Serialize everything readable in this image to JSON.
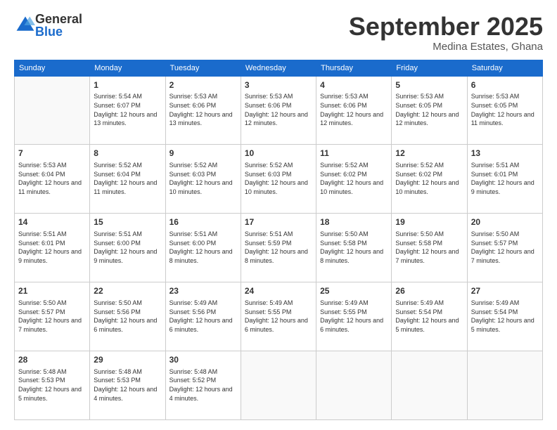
{
  "header": {
    "logo_general": "General",
    "logo_blue": "Blue",
    "month_title": "September 2025",
    "location": "Medina Estates, Ghana"
  },
  "days_of_week": [
    "Sunday",
    "Monday",
    "Tuesday",
    "Wednesday",
    "Thursday",
    "Friday",
    "Saturday"
  ],
  "weeks": [
    [
      {
        "day": "",
        "sunrise": "",
        "sunset": "",
        "daylight": ""
      },
      {
        "day": "1",
        "sunrise": "Sunrise: 5:54 AM",
        "sunset": "Sunset: 6:07 PM",
        "daylight": "Daylight: 12 hours and 13 minutes."
      },
      {
        "day": "2",
        "sunrise": "Sunrise: 5:53 AM",
        "sunset": "Sunset: 6:06 PM",
        "daylight": "Daylight: 12 hours and 13 minutes."
      },
      {
        "day": "3",
        "sunrise": "Sunrise: 5:53 AM",
        "sunset": "Sunset: 6:06 PM",
        "daylight": "Daylight: 12 hours and 12 minutes."
      },
      {
        "day": "4",
        "sunrise": "Sunrise: 5:53 AM",
        "sunset": "Sunset: 6:06 PM",
        "daylight": "Daylight: 12 hours and 12 minutes."
      },
      {
        "day": "5",
        "sunrise": "Sunrise: 5:53 AM",
        "sunset": "Sunset: 6:05 PM",
        "daylight": "Daylight: 12 hours and 12 minutes."
      },
      {
        "day": "6",
        "sunrise": "Sunrise: 5:53 AM",
        "sunset": "Sunset: 6:05 PM",
        "daylight": "Daylight: 12 hours and 11 minutes."
      }
    ],
    [
      {
        "day": "7",
        "sunrise": "Sunrise: 5:53 AM",
        "sunset": "Sunset: 6:04 PM",
        "daylight": "Daylight: 12 hours and 11 minutes."
      },
      {
        "day": "8",
        "sunrise": "Sunrise: 5:52 AM",
        "sunset": "Sunset: 6:04 PM",
        "daylight": "Daylight: 12 hours and 11 minutes."
      },
      {
        "day": "9",
        "sunrise": "Sunrise: 5:52 AM",
        "sunset": "Sunset: 6:03 PM",
        "daylight": "Daylight: 12 hours and 10 minutes."
      },
      {
        "day": "10",
        "sunrise": "Sunrise: 5:52 AM",
        "sunset": "Sunset: 6:03 PM",
        "daylight": "Daylight: 12 hours and 10 minutes."
      },
      {
        "day": "11",
        "sunrise": "Sunrise: 5:52 AM",
        "sunset": "Sunset: 6:02 PM",
        "daylight": "Daylight: 12 hours and 10 minutes."
      },
      {
        "day": "12",
        "sunrise": "Sunrise: 5:52 AM",
        "sunset": "Sunset: 6:02 PM",
        "daylight": "Daylight: 12 hours and 10 minutes."
      },
      {
        "day": "13",
        "sunrise": "Sunrise: 5:51 AM",
        "sunset": "Sunset: 6:01 PM",
        "daylight": "Daylight: 12 hours and 9 minutes."
      }
    ],
    [
      {
        "day": "14",
        "sunrise": "Sunrise: 5:51 AM",
        "sunset": "Sunset: 6:01 PM",
        "daylight": "Daylight: 12 hours and 9 minutes."
      },
      {
        "day": "15",
        "sunrise": "Sunrise: 5:51 AM",
        "sunset": "Sunset: 6:00 PM",
        "daylight": "Daylight: 12 hours and 9 minutes."
      },
      {
        "day": "16",
        "sunrise": "Sunrise: 5:51 AM",
        "sunset": "Sunset: 6:00 PM",
        "daylight": "Daylight: 12 hours and 8 minutes."
      },
      {
        "day": "17",
        "sunrise": "Sunrise: 5:51 AM",
        "sunset": "Sunset: 5:59 PM",
        "daylight": "Daylight: 12 hours and 8 minutes."
      },
      {
        "day": "18",
        "sunrise": "Sunrise: 5:50 AM",
        "sunset": "Sunset: 5:58 PM",
        "daylight": "Daylight: 12 hours and 8 minutes."
      },
      {
        "day": "19",
        "sunrise": "Sunrise: 5:50 AM",
        "sunset": "Sunset: 5:58 PM",
        "daylight": "Daylight: 12 hours and 7 minutes."
      },
      {
        "day": "20",
        "sunrise": "Sunrise: 5:50 AM",
        "sunset": "Sunset: 5:57 PM",
        "daylight": "Daylight: 12 hours and 7 minutes."
      }
    ],
    [
      {
        "day": "21",
        "sunrise": "Sunrise: 5:50 AM",
        "sunset": "Sunset: 5:57 PM",
        "daylight": "Daylight: 12 hours and 7 minutes."
      },
      {
        "day": "22",
        "sunrise": "Sunrise: 5:50 AM",
        "sunset": "Sunset: 5:56 PM",
        "daylight": "Daylight: 12 hours and 6 minutes."
      },
      {
        "day": "23",
        "sunrise": "Sunrise: 5:49 AM",
        "sunset": "Sunset: 5:56 PM",
        "daylight": "Daylight: 12 hours and 6 minutes."
      },
      {
        "day": "24",
        "sunrise": "Sunrise: 5:49 AM",
        "sunset": "Sunset: 5:55 PM",
        "daylight": "Daylight: 12 hours and 6 minutes."
      },
      {
        "day": "25",
        "sunrise": "Sunrise: 5:49 AM",
        "sunset": "Sunset: 5:55 PM",
        "daylight": "Daylight: 12 hours and 6 minutes."
      },
      {
        "day": "26",
        "sunrise": "Sunrise: 5:49 AM",
        "sunset": "Sunset: 5:54 PM",
        "daylight": "Daylight: 12 hours and 5 minutes."
      },
      {
        "day": "27",
        "sunrise": "Sunrise: 5:49 AM",
        "sunset": "Sunset: 5:54 PM",
        "daylight": "Daylight: 12 hours and 5 minutes."
      }
    ],
    [
      {
        "day": "28",
        "sunrise": "Sunrise: 5:48 AM",
        "sunset": "Sunset: 5:53 PM",
        "daylight": "Daylight: 12 hours and 5 minutes."
      },
      {
        "day": "29",
        "sunrise": "Sunrise: 5:48 AM",
        "sunset": "Sunset: 5:53 PM",
        "daylight": "Daylight: 12 hours and 4 minutes."
      },
      {
        "day": "30",
        "sunrise": "Sunrise: 5:48 AM",
        "sunset": "Sunset: 5:52 PM",
        "daylight": "Daylight: 12 hours and 4 minutes."
      },
      {
        "day": "",
        "sunrise": "",
        "sunset": "",
        "daylight": ""
      },
      {
        "day": "",
        "sunrise": "",
        "sunset": "",
        "daylight": ""
      },
      {
        "day": "",
        "sunrise": "",
        "sunset": "",
        "daylight": ""
      },
      {
        "day": "",
        "sunrise": "",
        "sunset": "",
        "daylight": ""
      }
    ]
  ]
}
